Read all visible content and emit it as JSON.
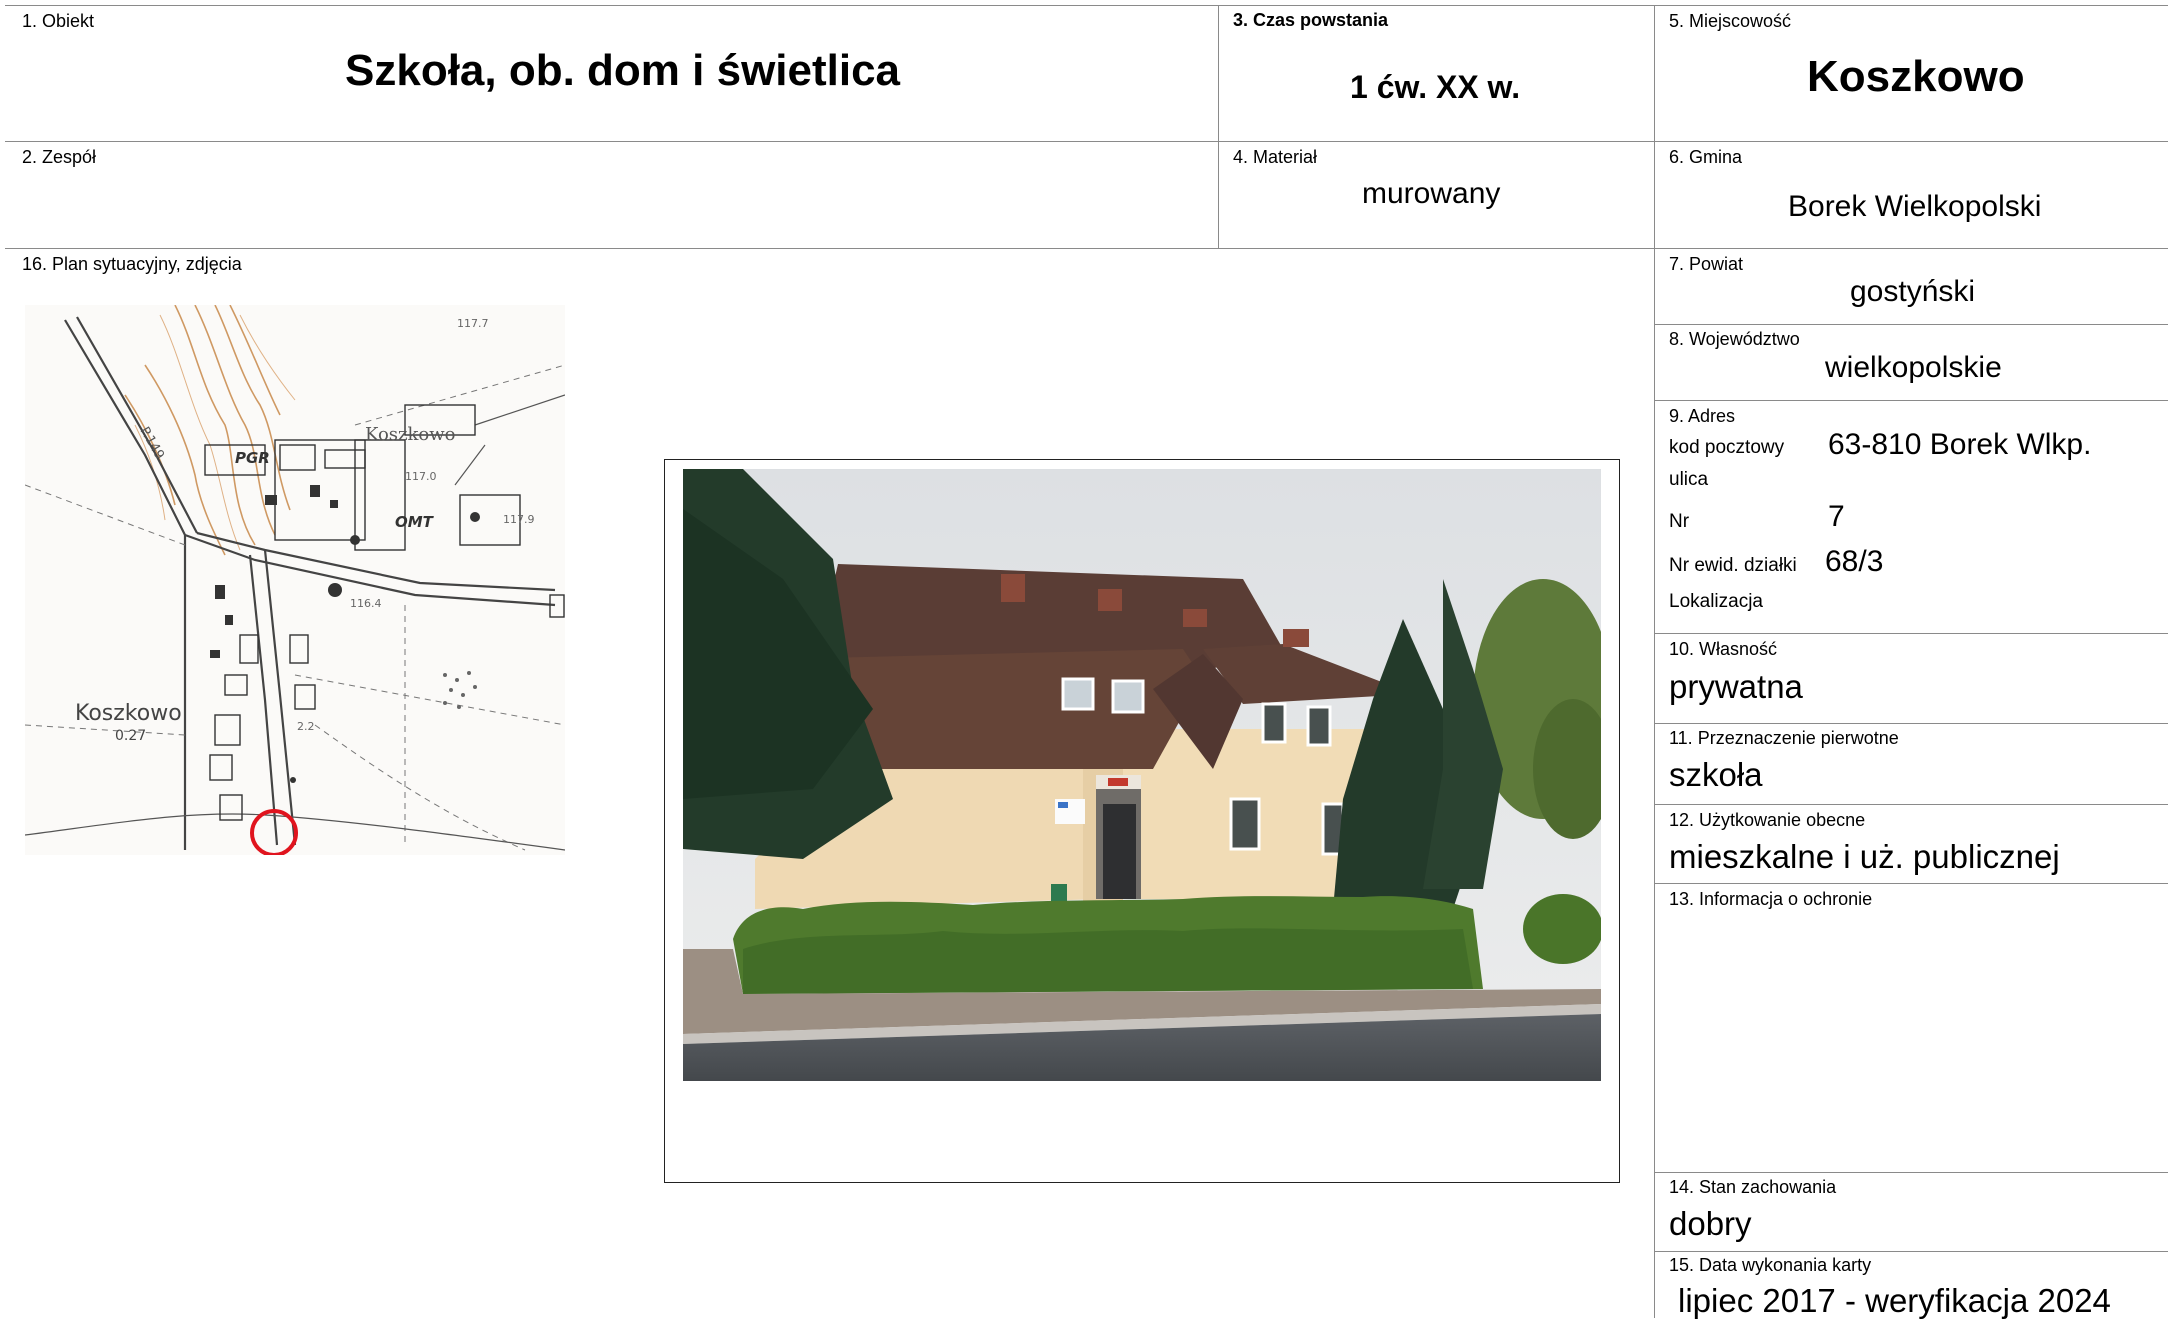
{
  "fields": {
    "obiekt_label": "1. Obiekt",
    "obiekt": "Szkoła, ob. dom i świetlica",
    "zespol_label": "2. Zespół",
    "czas_label": "3. Czas powstania",
    "czas": "1 ćw. XX w.",
    "material_label": "4. Materiał",
    "material": "murowany",
    "miejscowosc_label": "5. Miejscowość",
    "miejscowosc": "Koszkowo",
    "gmina_label": "6. Gmina",
    "gmina": "Borek Wielkopolski",
    "powiat_label": "7. Powiat",
    "powiat": "gostyński",
    "wojewodztwo_label": "8. Województwo",
    "wojewodztwo": "wielkopolskie",
    "adres_label": "9. Adres",
    "kod_label": "kod pocztowy",
    "kod": "63-810 Borek Wlkp.",
    "ulica_label": "ulica",
    "nr_label": "Nr",
    "nr": "7",
    "dzialka_label": "Nr ewid. działki",
    "dzialka": "68/3",
    "lokalizacja_label": "Lokalizacja",
    "wlasnosc_label": "10. Własność",
    "wlasnosc": "prywatna",
    "przeznaczenie_label": "11. Przeznaczenie pierwotne",
    "przeznaczenie": "szkoła",
    "uzytkowanie_label": "12. Użytkowanie obecne",
    "uzytkowanie": "mieszkalne i uż. publicznej",
    "ochrona_label": "13. Informacja o ochronie",
    "stan_label": "14. Stan zachowania",
    "stan": "dobry",
    "data_label": "15. Data wykonania karty",
    "data": "lipiec 2017 - weryfikacja 2024",
    "plan_label": "16. Plan sytuacyjny, zdjęcia"
  },
  "map": {
    "place_label_1": "Koszkowo",
    "place_label_2": "Koszkowo",
    "place_sub": "0.27",
    "pgr": "PGR",
    "omt": "OMT",
    "road": "P.149",
    "spot_1": "117.7",
    "spot_2": "117.9",
    "spot_3": "116.4",
    "spot_4": "117.0",
    "spot_5": "2.2",
    "marker_color": "#e0141e"
  },
  "colors": {
    "rule": "#8a8a8a"
  }
}
